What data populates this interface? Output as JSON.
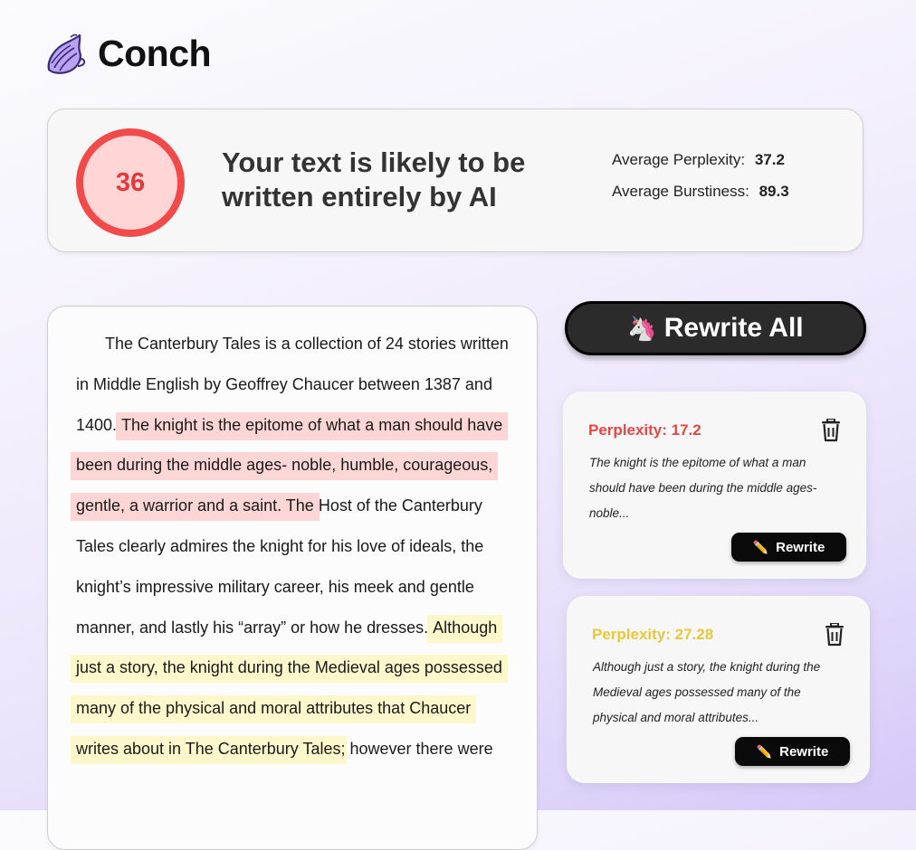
{
  "brand": {
    "name": "Conch",
    "logo_icon": "conch-shell-icon"
  },
  "score": {
    "value": "36",
    "verdict": "Your text is likely to be written entirely by AI",
    "ring_color": "#f24a4a",
    "fill_color": "#ffd5d5"
  },
  "metrics": {
    "perplexity_label": "Average Perplexity:",
    "perplexity_value": "37.2",
    "burstiness_label": "Average Burstiness:",
    "burstiness_value": "89.3"
  },
  "essay": {
    "part1": "The Canterbury Tales is a collection of 24 stories written in Middle English by Geoffrey Chaucer between 1387 and 1400. ",
    "highlight1": "The knight is the epitome of what a man should have been during the middle ages- noble, humble, courageous, gentle, a warrior and a saint. The",
    "part2": " Host of the Canterbury Tales clearly admires the knight for his love of ideals, the knight’s impressive military career, his meek and gentle manner, and lastly his “array” or how he dresses. ",
    "highlight2": "Although just a story, the knight during the Medieval ages possessed many of the physical and moral attributes that Chaucer writes about in The Canterbury Tales",
    "part3": "; however there were",
    "highlight1_color": "#fcd5d5",
    "highlight2_color": "#fdf8cc"
  },
  "rewrite_all": {
    "emoji": "🦄",
    "label": "Rewrite All"
  },
  "suggestions": [
    {
      "title": "Perplexity: 17.2",
      "title_color": "#e84545",
      "snippet": "The knight is the epitome of what a man should have been during the middle ages- noble...",
      "button_emoji": "✏️",
      "button_label": "Rewrite",
      "delete_icon": "trash-icon"
    },
    {
      "title": "Perplexity: 27.28",
      "title_color": "#e8c83a",
      "snippet": "Although just a story, the knight during the Medieval ages possessed many of the physical and moral attributes...",
      "button_emoji": "✏️",
      "button_label": "Rewrite",
      "delete_icon": "trash-icon"
    }
  ]
}
